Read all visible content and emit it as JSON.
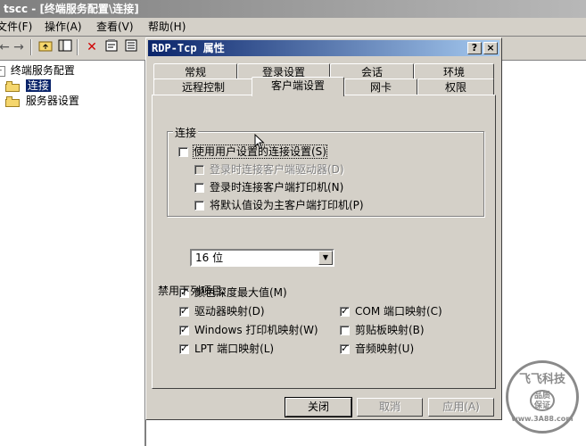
{
  "mmc": {
    "title": "tscc - [终端服务配置\\连接]",
    "menu": [
      "文件(F)",
      "操作(A)",
      "查看(V)",
      "帮助(H)"
    ],
    "tree": {
      "root": "终端服务配置",
      "items": [
        "连接",
        "服务器设置"
      ]
    }
  },
  "dialog": {
    "title": "RDP-Tcp 属性",
    "help_button": "?",
    "close_button": "×",
    "tabs_back": [
      "常规",
      "登录设置",
      "会话",
      "环境"
    ],
    "tabs_front": [
      "远程控制",
      "客户端设置",
      "网卡",
      "权限"
    ],
    "active_tab": "客户端设置",
    "connection": {
      "group_label": "连接",
      "use_user_settings": {
        "label": "使用用户设置的连接设置(S)",
        "checked": false
      },
      "connect_drives": {
        "label": "登录时连接客户端驱动器(D)",
        "checked": false,
        "disabled": true
      },
      "connect_printers": {
        "label": "登录时连接客户端打印机(N)",
        "checked": false
      },
      "default_printer": {
        "label": "将默认值设为主客户端打印机(P)",
        "checked": false
      }
    },
    "color_depth": {
      "label": "颜色深度最大值(M)",
      "checked": true,
      "value": "16 位"
    },
    "disable_section": {
      "label": "禁用下列项目:",
      "items": [
        {
          "label": "驱动器映射(D)",
          "checked": true
        },
        {
          "label": "COM 端口映射(C)",
          "checked": true
        },
        {
          "label": "Windows 打印机映射(W)",
          "checked": true
        },
        {
          "label": "剪贴板映射(B)",
          "checked": false
        },
        {
          "label": "LPT 端口映射(L)",
          "checked": true
        },
        {
          "label": "音频映射(U)",
          "checked": true
        }
      ]
    },
    "buttons": {
      "close": "关闭",
      "cancel": "取消",
      "apply": "应用(A)"
    }
  },
  "watermark": {
    "top": "飞飞科技",
    "middle": "品质保证",
    "url": "www.3A88.com"
  }
}
